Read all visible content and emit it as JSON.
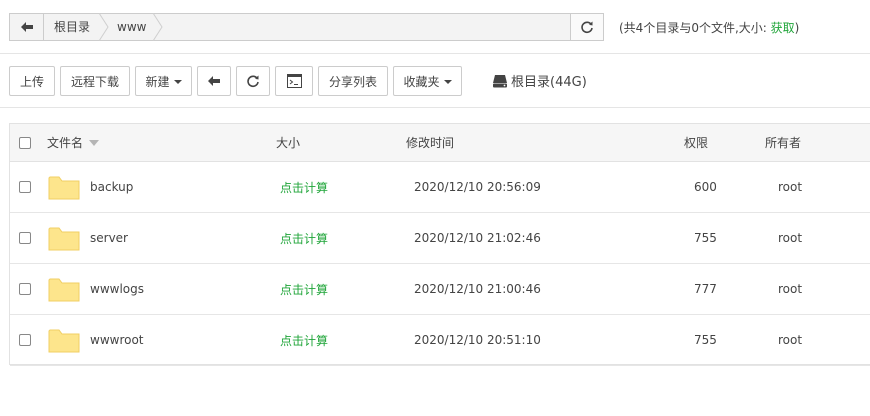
{
  "path": {
    "crumbs": [
      "根目录",
      "www"
    ]
  },
  "summary": {
    "text": "(共4个目录与0个文件,大小: ",
    "link": "获取",
    "close": ")"
  },
  "toolbar": {
    "upload": "上传",
    "remote_download": "远程下载",
    "new": "新建",
    "share_list": "分享列表",
    "favorites": "收藏夹",
    "disk": "根目录(44G)"
  },
  "table": {
    "headers": {
      "name": "文件名",
      "size": "大小",
      "mtime": "修改时间",
      "perm": "权限",
      "owner": "所有者"
    },
    "rows": [
      {
        "name": "backup",
        "size": "点击计算",
        "mtime": "2020/12/10 20:56:09",
        "perm": "600",
        "owner": "root"
      },
      {
        "name": "server",
        "size": "点击计算",
        "mtime": "2020/12/10 21:02:46",
        "perm": "755",
        "owner": "root"
      },
      {
        "name": "wwwlogs",
        "size": "点击计算",
        "mtime": "2020/12/10 21:00:46",
        "perm": "777",
        "owner": "root"
      },
      {
        "name": "wwwroot",
        "size": "点击计算",
        "mtime": "2020/12/10 20:51:10",
        "perm": "755",
        "owner": "root"
      }
    ]
  },
  "colors": {
    "accent_green": "#20a53a",
    "folder_fill": "#fde58c",
    "folder_tab": "#f6d46a"
  }
}
